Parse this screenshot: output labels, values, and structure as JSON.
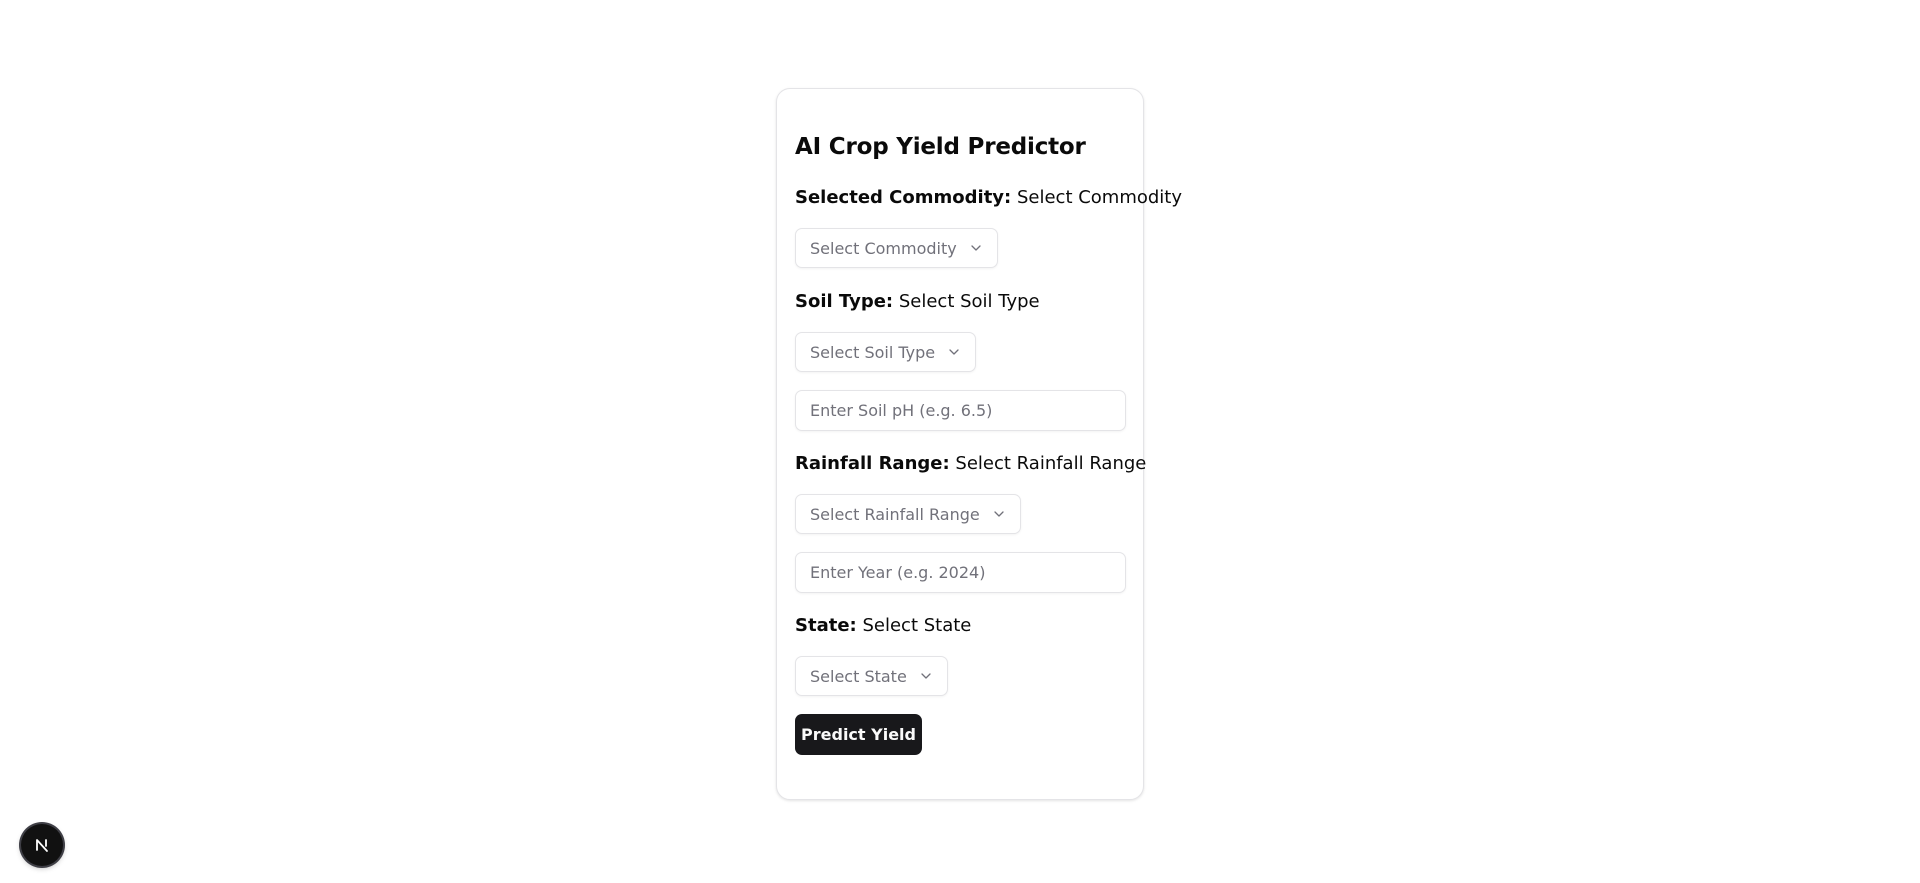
{
  "form": {
    "title": "AI Crop Yield Predictor",
    "commodity": {
      "label": "Selected Commodity:",
      "value": "Select Commodity",
      "select_placeholder": "Select Commodity"
    },
    "soil_type": {
      "label": "Soil Type:",
      "value": "Select Soil Type",
      "select_placeholder": "Select Soil Type"
    },
    "soil_ph": {
      "placeholder": "Enter Soil pH (e.g. 6.5)",
      "value": ""
    },
    "rainfall": {
      "label": "Rainfall Range:",
      "value": "Select Rainfall Range",
      "select_placeholder": "Select Rainfall Range"
    },
    "year": {
      "placeholder": "Enter Year (e.g. 2024)",
      "value": ""
    },
    "state": {
      "label": "State:",
      "value": "Select State",
      "select_placeholder": "Select State"
    },
    "submit_label": "Predict Yield"
  },
  "dev_badge": {
    "icon": "nextjs-logo-icon"
  },
  "colors": {
    "primary_button": "#18181b",
    "border": "#e4e4e7",
    "placeholder": "#71717a"
  }
}
